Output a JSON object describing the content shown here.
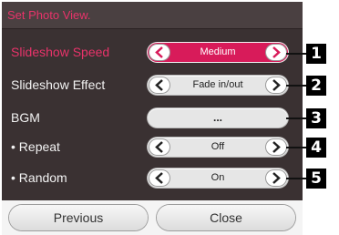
{
  "dialog": {
    "title": "Set Photo View."
  },
  "rows": [
    {
      "label": "Slideshow Speed",
      "value": "Medium"
    },
    {
      "label": "Slideshow Effect",
      "value": "Fade in/out"
    },
    {
      "label": "BGM",
      "value": "..."
    },
    {
      "label": "• Repeat",
      "value": "Off"
    },
    {
      "label": "• Random",
      "value": "On"
    }
  ],
  "callouts": [
    "1",
    "2",
    "3",
    "4",
    "5"
  ],
  "buttons": {
    "previous": "Previous",
    "close": "Close"
  },
  "colors": {
    "accent": "#e8336a",
    "selected_control": "#d81b5a",
    "panel": "#3a3132"
  },
  "icons": {
    "left": "chevron-left-icon",
    "right": "chevron-right-icon"
  }
}
